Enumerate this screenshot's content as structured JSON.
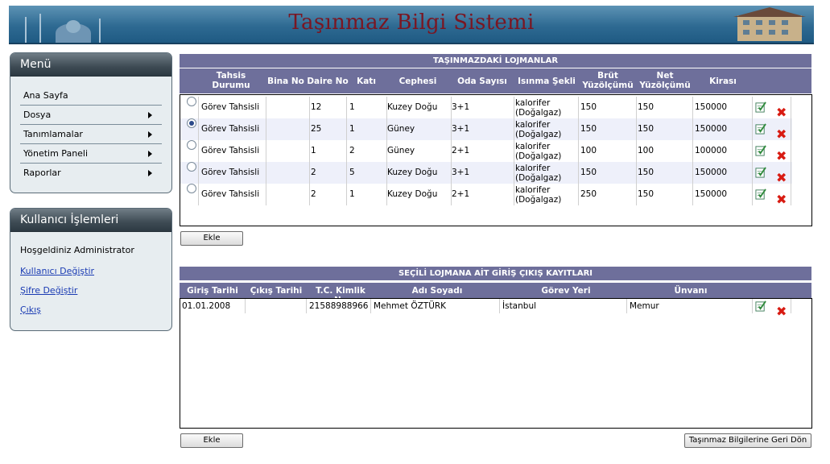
{
  "header": {
    "title": "Taşınmaz Bilgi Sistemi"
  },
  "menu": {
    "title": "Menü",
    "items": [
      {
        "label": "Ana Sayfa",
        "has_submenu": false
      },
      {
        "label": "Dosya",
        "has_submenu": true
      },
      {
        "label": "Tanımlamalar",
        "has_submenu": true
      },
      {
        "label": "Yönetim Paneli",
        "has_submenu": true
      },
      {
        "label": "Raporlar",
        "has_submenu": true
      }
    ]
  },
  "user": {
    "title": "Kullanıcı İşlemleri",
    "welcome": "Hoşgeldiniz Administrator",
    "links": [
      "Kullanıcı Değiştir",
      "Şifre Değiştir",
      "Çıkış"
    ]
  },
  "lodgings": {
    "title": "TAŞINMAZDAKİ LOJMANLAR",
    "columns": [
      "Tahsis Durumu",
      "Bina No",
      "Daire No",
      "Katı",
      "Cephesi",
      "Oda Sayısı",
      "Isınma Şekli",
      "Brüt Yüzölçümü",
      "Net Yüzölçümü",
      "Kirası"
    ],
    "rows": [
      {
        "selected": false,
        "tahsis": "Görev Tahsisli",
        "bina": "",
        "daire": "12",
        "kat": "1",
        "cephe": "Kuzey Doğu",
        "oda": "3+1",
        "isinma": "kalorifer (Doğalgaz)",
        "brut": "150",
        "net": "150",
        "kira": "150000"
      },
      {
        "selected": true,
        "tahsis": "Görev Tahsisli",
        "bina": "",
        "daire": "25",
        "kat": "1",
        "cephe": "Güney",
        "oda": "3+1",
        "isinma": "kalorifer (Doğalgaz)",
        "brut": "150",
        "net": "150",
        "kira": "150000"
      },
      {
        "selected": false,
        "tahsis": "Görev Tahsisli",
        "bina": "",
        "daire": "1",
        "kat": "2",
        "cephe": "Güney",
        "oda": "2+1",
        "isinma": "kalorifer (Doğalgaz)",
        "brut": "100",
        "net": "100",
        "kira": "100000"
      },
      {
        "selected": false,
        "tahsis": "Görev Tahsisli",
        "bina": "",
        "daire": "2",
        "kat": "5",
        "cephe": "Kuzey Doğu",
        "oda": "3+1",
        "isinma": "kalorifer (Doğalgaz)",
        "brut": "150",
        "net": "150",
        "kira": "150000"
      },
      {
        "selected": false,
        "tahsis": "Görev Tahsisli",
        "bina": "",
        "daire": "2",
        "kat": "1",
        "cephe": "Kuzey Doğu",
        "oda": "2+1",
        "isinma": "kalorifer (Doğalgaz)",
        "brut": "250",
        "net": "150",
        "kira": "150000"
      }
    ],
    "add_label": "Ekle"
  },
  "records": {
    "title": "SEÇİLİ LOJMANA AİT GİRİŞ ÇIKIŞ KAYITLARI",
    "columns": [
      "Giriş Tarihi",
      "Çıkış Tarihi",
      "T.C. Kimlik No",
      "Adı Soyadı",
      "Görev Yeri",
      "Ünvanı"
    ],
    "rows": [
      {
        "giris": "01.01.2008",
        "cikis": "",
        "tc": "21588988966",
        "ad": "Mehmet ÖZTÜRK",
        "gorev": "İstanbul",
        "unvan": "Memur"
      }
    ],
    "add_label": "Ekle",
    "back_label": "Taşınmaz Bilgilerine Geri Dön"
  }
}
